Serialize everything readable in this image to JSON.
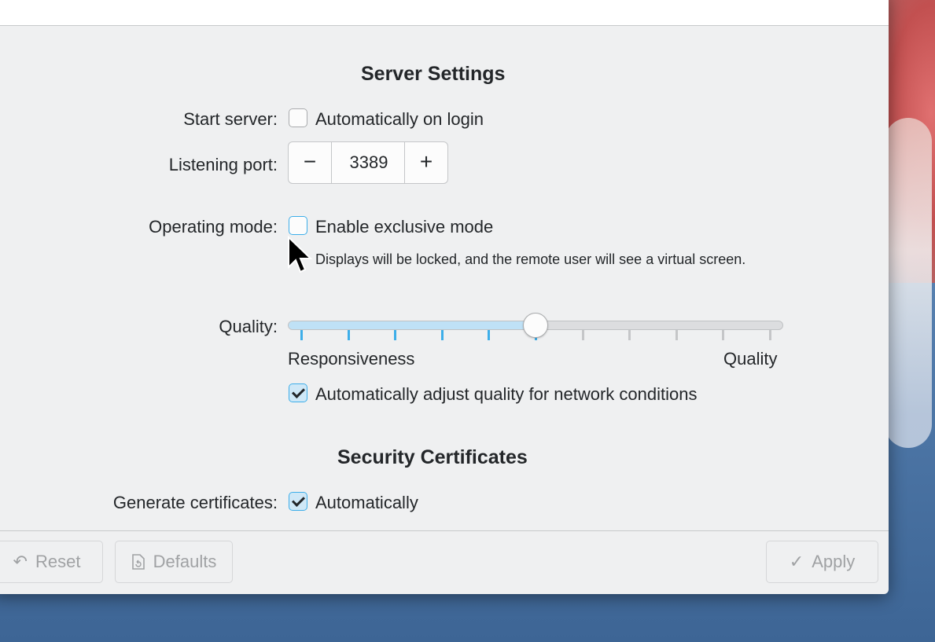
{
  "server_section": {
    "heading": "Server Settings",
    "start_server_label": "Start server:",
    "start_server_option": "Automatically on login",
    "start_server_checked": false,
    "listening_port_label": "Listening port:",
    "listening_port_value": "3389",
    "minus": "−",
    "plus": "+",
    "operating_mode_label": "Operating mode:",
    "exclusive_mode_option": "Enable exclusive mode",
    "exclusive_mode_checked": false,
    "exclusive_mode_hint": "Displays will be locked, and the remote user will see a virtual screen.",
    "quality_label": "Quality:",
    "quality_level": 0.5,
    "quality_min_label": "Responsiveness",
    "quality_max_label": "Quality",
    "auto_adjust_option": "Automatically adjust quality for network conditions",
    "auto_adjust_checked": true
  },
  "security_section": {
    "heading": "Security Certificates",
    "generate_label": "Generate certificates:",
    "generate_option": "Automatically",
    "generate_checked": true
  },
  "footer": {
    "reset_label": "Reset",
    "defaults_label": "Defaults",
    "apply_label": "Apply",
    "reset_icon": "undo-icon",
    "defaults_icon": "document-revert-icon",
    "apply_icon": "checkmark-icon"
  },
  "colors": {
    "accent": "#3daee9",
    "window_bg": "#eff0f1",
    "text": "#232629",
    "disabled_text": "#a0a2a4"
  }
}
